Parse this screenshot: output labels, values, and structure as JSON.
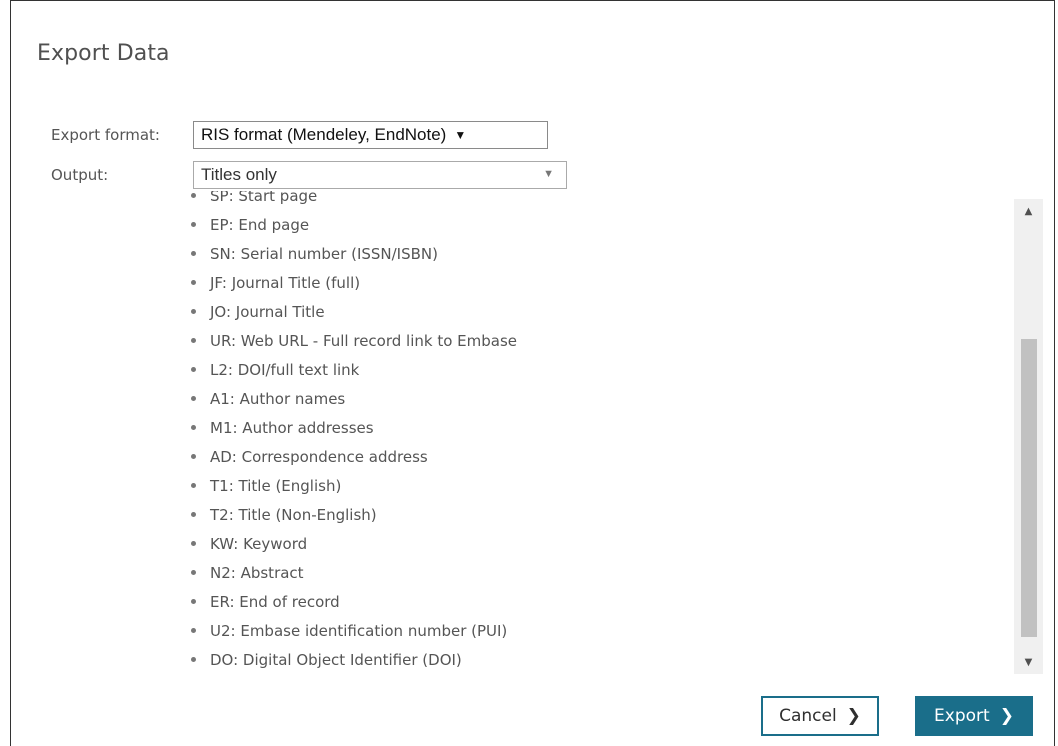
{
  "dialog": {
    "title": "Export Data"
  },
  "form": {
    "export_format_label": "Export format:",
    "export_format_value": "RIS format (Mendeley, EndNote)",
    "output_label": "Output:",
    "output_value": "Titles only"
  },
  "fields": [
    "SP: Start page",
    "EP: End page",
    "SN: Serial number (ISSN/ISBN)",
    "JF: Journal Title (full)",
    "JO: Journal Title",
    "UR: Web URL - Full record link to Embase",
    "L2: DOI/full text link",
    "A1: Author names",
    "M1: Author addresses",
    "AD: Correspondence address",
    "T1: Title (English)",
    "T2: Title (Non-English)",
    "KW: Keyword",
    "N2: Abstract",
    "ER: End of record",
    "U2: Embase identification number (PUI)",
    "DO: Digital Object Identifier (DOI)"
  ],
  "buttons": {
    "cancel_label": "Cancel",
    "export_label": "Export"
  },
  "icons": {
    "dropdown_arrow": "▼",
    "output_arrow": "▼",
    "scroll_up": "▲",
    "scroll_down": "▼",
    "chevron_right": "❯"
  },
  "colors": {
    "accent": "#1a6e8a"
  }
}
